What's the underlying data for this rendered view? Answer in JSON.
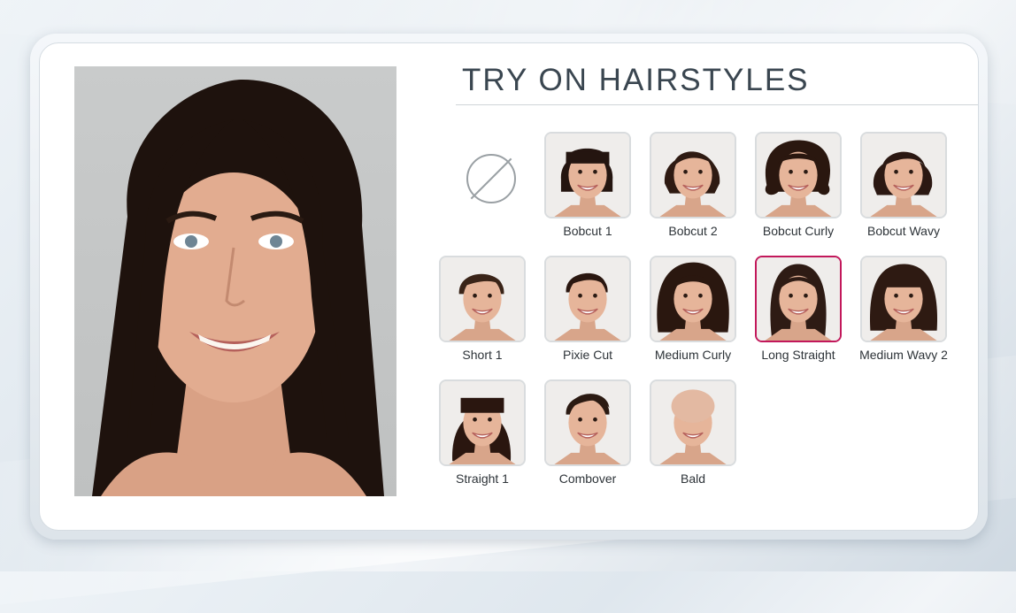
{
  "title": "TRY ON HAIRSTYLES",
  "no_style_icon": "no-hairstyle-icon",
  "selected_style": "Long Straight",
  "accent_color": "#c2185b",
  "hairstyles": [
    {
      "label": "Bobcut 1",
      "hair": "bob",
      "color": "#241510"
    },
    {
      "label": "Bobcut 2",
      "hair": "bob2",
      "color": "#2e1a12"
    },
    {
      "label": "Bobcut Curly",
      "hair": "curly",
      "color": "#2a170f"
    },
    {
      "label": "Bobcut Wavy",
      "hair": "wavy",
      "color": "#2b1812"
    },
    {
      "label": "Short 1",
      "hair": "short",
      "color": "#3a2418"
    },
    {
      "label": "Pixie Cut",
      "hair": "pixie",
      "color": "#2a1710"
    },
    {
      "label": "Medium Curly",
      "hair": "medcurly",
      "color": "#2a170f"
    },
    {
      "label": "Long Straight",
      "hair": "long",
      "color": "#2e1b14"
    },
    {
      "label": "Medium Wavy 2",
      "hair": "medwavy",
      "color": "#2e1a12"
    },
    {
      "label": "Straight 1",
      "hair": "straight",
      "color": "#2a160f"
    },
    {
      "label": "Combover",
      "hair": "comb",
      "color": "#2b1a12"
    },
    {
      "label": "Bald",
      "hair": "bald",
      "color": "#e3b9a2"
    }
  ]
}
